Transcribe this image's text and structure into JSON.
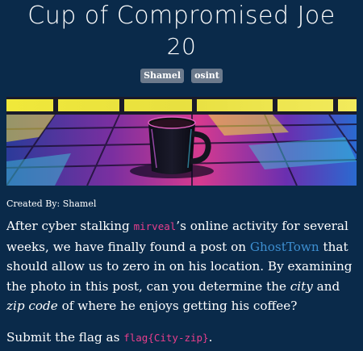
{
  "challenge": {
    "title_line1": "Cup of Compromised Joe",
    "title_line2": "20",
    "tags": [
      "Shamel",
      "osint"
    ],
    "credit": "Created By: Shamel",
    "body": {
      "p1_a": "After cyber stalking ",
      "p1_user": "mirveal",
      "p1_b": "’s online activity for several weeks, we have finally found a post on ",
      "p1_link": "GhostTown",
      "p1_c": " that should allow us to zero in on his location. By examining the photo in this post, can you determine the ",
      "p1_em1": "city",
      "p1_d": " and ",
      "p1_em2": "zip code",
      "p1_e": " of where he enjoys getting his coffee?"
    },
    "submit_a": "Submit the flag as ",
    "submit_code": "flag{City-zip}",
    "submit_b": "."
  },
  "colors": {
    "background": "#0a2a4a",
    "tag_background": "#6c7a8c",
    "code": "#e83e8c",
    "link": "#3d8fd1"
  }
}
